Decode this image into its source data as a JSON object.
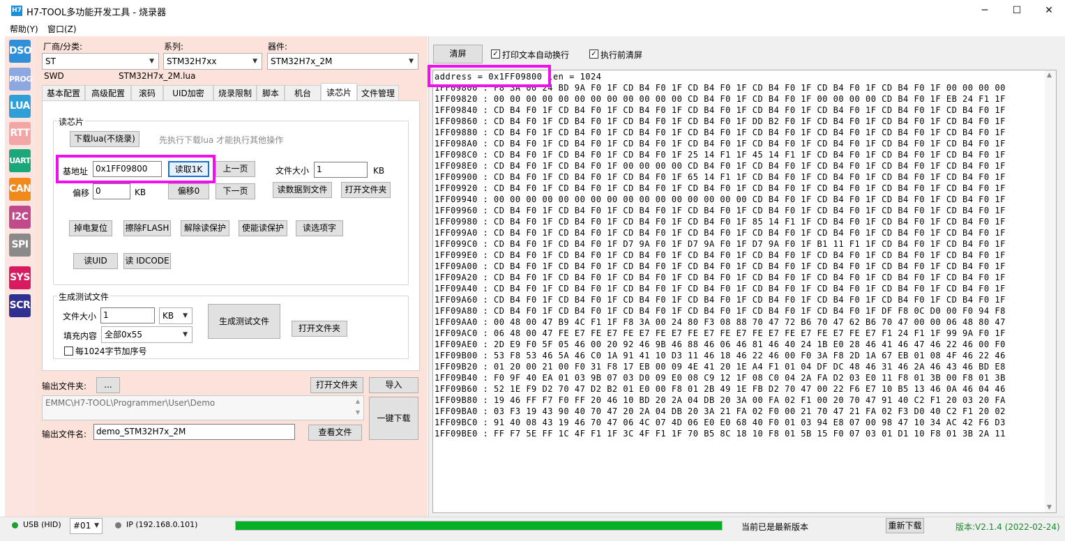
{
  "window": {
    "icon_text": "H7",
    "title": "H7-TOOL多功能开发工具 - 烧录器",
    "minimize_glyph": "─",
    "maximize_glyph": "☐",
    "close_glyph": "✕"
  },
  "menu": [
    "帮助(Y)",
    "窗口(Z)"
  ],
  "sidebar": [
    {
      "label": "DSO",
      "color": "#2f8fd8"
    },
    {
      "label": "PROG",
      "color": "#8da8e0"
    },
    {
      "label": "LUA",
      "color": "#2f9fd8"
    },
    {
      "label": "RTT",
      "color": "#f2a6a6"
    },
    {
      "label": "UART",
      "color": "#1aa87a"
    },
    {
      "label": "CAN",
      "color": "#f08a1c"
    },
    {
      "label": "I2C",
      "color": "#c04a8a"
    },
    {
      "label": "SPI",
      "color": "#8a8a8a"
    },
    {
      "label": "SYS",
      "color": "#d81b60"
    },
    {
      "label": "SCR",
      "color": "#303090"
    }
  ],
  "selectors": {
    "vendor_label": "厂商/分类:",
    "vendor_value": "ST",
    "series_label": "系列:",
    "series_value": "STM32H7xx",
    "device_label": "器件:",
    "device_value": "STM32H7x_2M",
    "interface_text": "SWD",
    "lua_file_text": "STM32H7x_2M.lua"
  },
  "tabs": [
    "基本配置",
    "高级配置",
    "滚码",
    "UID加密",
    "烧录限制",
    "脚本",
    "机台",
    "读芯片",
    "文件管理"
  ],
  "active_tab": "读芯片",
  "read_chip": {
    "group_title": "读芯片",
    "download_lua_button": "下载lua(不烧录)",
    "hint_text": "先执行下载lua 才能执行其他操作",
    "base_addr_label": "基地址",
    "base_addr_value": "0x1FF09800",
    "read_1k_button": "读取1K",
    "prev_page_button": "上一页",
    "file_size_label": "文件大小",
    "file_size_value": "1",
    "file_size_unit": "KB",
    "offset_label": "偏移",
    "offset_value": "0",
    "offset_unit": "KB",
    "offset_zero_button": "偏移0",
    "next_page_button": "下一页",
    "read_to_file_button": "读数据到文件",
    "open_folder_button": "打开文件夹",
    "power_reset_button": "掉电复位",
    "erase_flash_button": "擦除FLASH",
    "unlock_button": "解除读保护",
    "lock_button": "使能读保护",
    "read_options_button": "读选项字",
    "read_uid_button": "读UID",
    "read_idcode_button": "读 IDCODE"
  },
  "gen_test": {
    "group_title": "生成测试文件",
    "file_size_label": "文件大小",
    "file_size_value": "1",
    "unit_value": "KB",
    "fill_label": "填充内容",
    "fill_value": "全部0x55",
    "seq_checkbox_label": "每1024字节加序号",
    "generate_button": "生成测试文件",
    "open_folder_button": "打开文件夹"
  },
  "output": {
    "folder_label": "输出文件夹:",
    "browse_button": "...",
    "open_folder_button": "打开文件夹",
    "import_button": "导入",
    "path_value": "EMMC\\H7-TOOL\\Programmer\\User\\Demo",
    "one_key_button": "一键下载",
    "filename_label": "输出文件名:",
    "filename_value": "demo_STM32H7x_2M",
    "view_file_button": "查看文件"
  },
  "right": {
    "clear_button": "清屏",
    "wrap_checkbox_label": "打印文本自动换行",
    "wrap_checked": true,
    "clear_before_label": "执行前清屏",
    "clear_before_checked": true,
    "header_addr": "address = 0x1FF09800",
    "header_len": " len = 1024",
    "hex_lines": [
      "1FF09800 : F8 3A 00 24 BD 9A F0 1F CD B4 F0 1F CD B4 F0 1F CD B4 F0 1F CD B4 F0 1F CD B4 F0 1F 00 00 00 00",
      "1FF09820 : 00 00 00 00 00 00 00 00 00 00 00 00 CD B4 F0 1F CD B4 F0 1F 00 00 00 00 CD B4 F0 1F EB 24 F1 1F",
      "1FF09840 : CD B4 F0 1F CD B4 F0 1F CD B4 F0 1F CD B4 F0 1F CD B4 F0 1F CD B4 F0 1F CD B4 F0 1F CD B4 F0 1F",
      "1FF09860 : CD B4 F0 1F CD B4 F0 1F CD B4 F0 1F CD B4 F0 1F DD B2 F0 1F CD B4 F0 1F CD B4 F0 1F CD B4 F0 1F",
      "1FF09880 : CD B4 F0 1F CD B4 F0 1F CD B4 F0 1F CD B4 F0 1F CD B4 F0 1F CD B4 F0 1F CD B4 F0 1F CD B4 F0 1F",
      "1FF098A0 : CD B4 F0 1F CD B4 F0 1F CD B4 F0 1F CD B4 F0 1F CD B4 F0 1F CD B4 F0 1F CD B4 F0 1F CD B4 F0 1F",
      "1FF098C0 : CD B4 F0 1F CD B4 F0 1F CD B4 F0 1F 25 14 F1 1F 45 14 F1 1F CD B4 F0 1F CD B4 F0 1F CD B4 F0 1F",
      "1FF098E0 : CD B4 F0 1F CD B4 F0 1F 00 00 00 00 CD B4 F0 1F CD B4 F0 1F CD B4 F0 1F CD B4 F0 1F CD B4 F0 1F",
      "1FF09900 : CD B4 F0 1F CD B4 F0 1F CD B4 F0 1F 65 14 F1 1F CD B4 F0 1F CD B4 F0 1F CD B4 F0 1F CD B4 F0 1F",
      "1FF09920 : CD B4 F0 1F CD B4 F0 1F CD B4 F0 1F CD B4 F0 1F CD B4 F0 1F CD B4 F0 1F CD B4 F0 1F CD B4 F0 1F",
      "1FF09940 : 00 00 00 00 00 00 00 00 00 00 00 00 00 00 00 00 CD B4 F0 1F CD B4 F0 1F CD B4 F0 1F CD B4 F0 1F",
      "1FF09960 : CD B4 F0 1F CD B4 F0 1F CD B4 F0 1F CD B4 F0 1F CD B4 F0 1F CD B4 F0 1F CD B4 F0 1F CD B4 F0 1F",
      "1FF09980 : CD B4 F0 1F CD B4 F0 1F CD B4 F0 1F CD B4 F0 1F 85 14 F1 1F CD B4 F0 1F CD B4 F0 1F CD B4 F0 1F",
      "1FF099A0 : CD B4 F0 1F CD B4 F0 1F CD B4 F0 1F CD B4 F0 1F CD B4 F0 1F CD B4 F0 1F CD B4 F0 1F CD B4 F0 1F",
      "1FF099C0 : CD B4 F0 1F CD B4 F0 1F D7 9A F0 1F D7 9A F0 1F D7 9A F0 1F B1 11 F1 1F CD B4 F0 1F CD B4 F0 1F",
      "1FF099E0 : CD B4 F0 1F CD B4 F0 1F CD B4 F0 1F CD B4 F0 1F CD B4 F0 1F CD B4 F0 1F CD B4 F0 1F CD B4 F0 1F",
      "1FF09A00 : CD B4 F0 1F CD B4 F0 1F CD B4 F0 1F CD B4 F0 1F CD B4 F0 1F CD B4 F0 1F CD B4 F0 1F CD B4 F0 1F",
      "1FF09A20 : CD B4 F0 1F CD B4 F0 1F CD B4 F0 1F CD B4 F0 1F CD B4 F0 1F CD B4 F0 1F CD B4 F0 1F CD B4 F0 1F",
      "1FF09A40 : CD B4 F0 1F CD B4 F0 1F CD B4 F0 1F CD B4 F0 1F CD B4 F0 1F CD B4 F0 1F CD B4 F0 1F CD B4 F0 1F",
      "1FF09A60 : CD B4 F0 1F CD B4 F0 1F CD B4 F0 1F CD B4 F0 1F CD B4 F0 1F CD B4 F0 1F CD B4 F0 1F CD B4 F0 1F",
      "1FF09A80 : CD B4 F0 1F CD B4 F0 1F CD B4 F0 1F CD B4 F0 1F CD B4 F0 1F CD B4 F0 1F DF F8 0C D0 00 F0 94 F8",
      "1FF09AA0 : 00 48 00 47 B9 4C F1 1F F8 3A 00 24 80 F3 08 88 70 47 72 B6 70 47 62 B6 70 47 00 00 06 48 80 47",
      "1FF09AC0 : 06 48 00 47 FE E7 FE E7 FE E7 FE E7 FE E7 FE E7 FE E7 FE E7 FE E7 FE E7 F1 24 F1 1F 99 9A F0 1F",
      "1FF09AE0 : 2D E9 F0 5F 05 46 00 20 92 46 9B 46 88 46 06 46 81 46 40 24 1B E0 28 46 41 46 47 46 22 46 00 F0",
      "1FF09B00 : 53 F8 53 46 5A 46 C0 1A 91 41 10 D3 11 46 18 46 22 46 00 F0 3A F8 2D 1A 67 EB 01 08 4F 46 22 46",
      "1FF09B20 : 01 20 00 21 00 F0 31 F8 17 EB 00 09 4E 41 20 1E A4 F1 01 04 DF DC 48 46 31 46 2A 46 43 46 BD E8",
      "1FF09B40 : F0 9F 40 EA 01 03 9B 07 03 D0 09 E0 08 C9 12 1F 08 C0 04 2A FA D2 03 E0 11 F8 01 3B 00 F8 01 3B",
      "1FF09B60 : 52 1E F9 D2 70 47 D2 B2 01 E0 00 F8 01 2B 49 1E FB D2 70 47 00 22 F6 E7 10 B5 13 46 0A 46 04 46",
      "1FF09B80 : 19 46 FF F7 F0 FF 20 46 10 BD 20 2A 04 DB 20 3A 00 FA 02 F1 00 20 70 47 91 40 C2 F1 20 03 20 FA",
      "1FF09BA0 : 03 F3 19 43 90 40 70 47 20 2A 04 DB 20 3A 21 FA 02 F0 00 21 70 47 21 FA 02 F3 D0 40 C2 F1 20 02",
      "1FF09BC0 : 91 40 08 43 19 46 70 47 06 4C 07 4D 06 E0 E0 68 40 F0 01 03 94 E8 07 00 98 47 10 34 AC 42 F6 D3",
      "1FF09BE0 : FF F7 5E FF 1C 4F F1 1F 3C 4F F1 1F 70 B5 8C 18 10 F8 01 5B 15 F0 07 03 01 D1 10 F8 01 3B 2A 11"
    ]
  },
  "status": {
    "usb_text": "USB (HID)",
    "device_no": "#01",
    "ip_text": "IP (192.168.0.101)",
    "progress_fraction": 1.0,
    "update_text": "当前已是最新版本",
    "redownload_button": "重新下载",
    "version_text": "版本:V2.1.4 (2022-02-24)",
    "usb_dot_color": "#1aa030",
    "ip_dot_color": "#7a7a7a",
    "progress_color": "#06b025",
    "version_color": "#1a8a2a"
  }
}
